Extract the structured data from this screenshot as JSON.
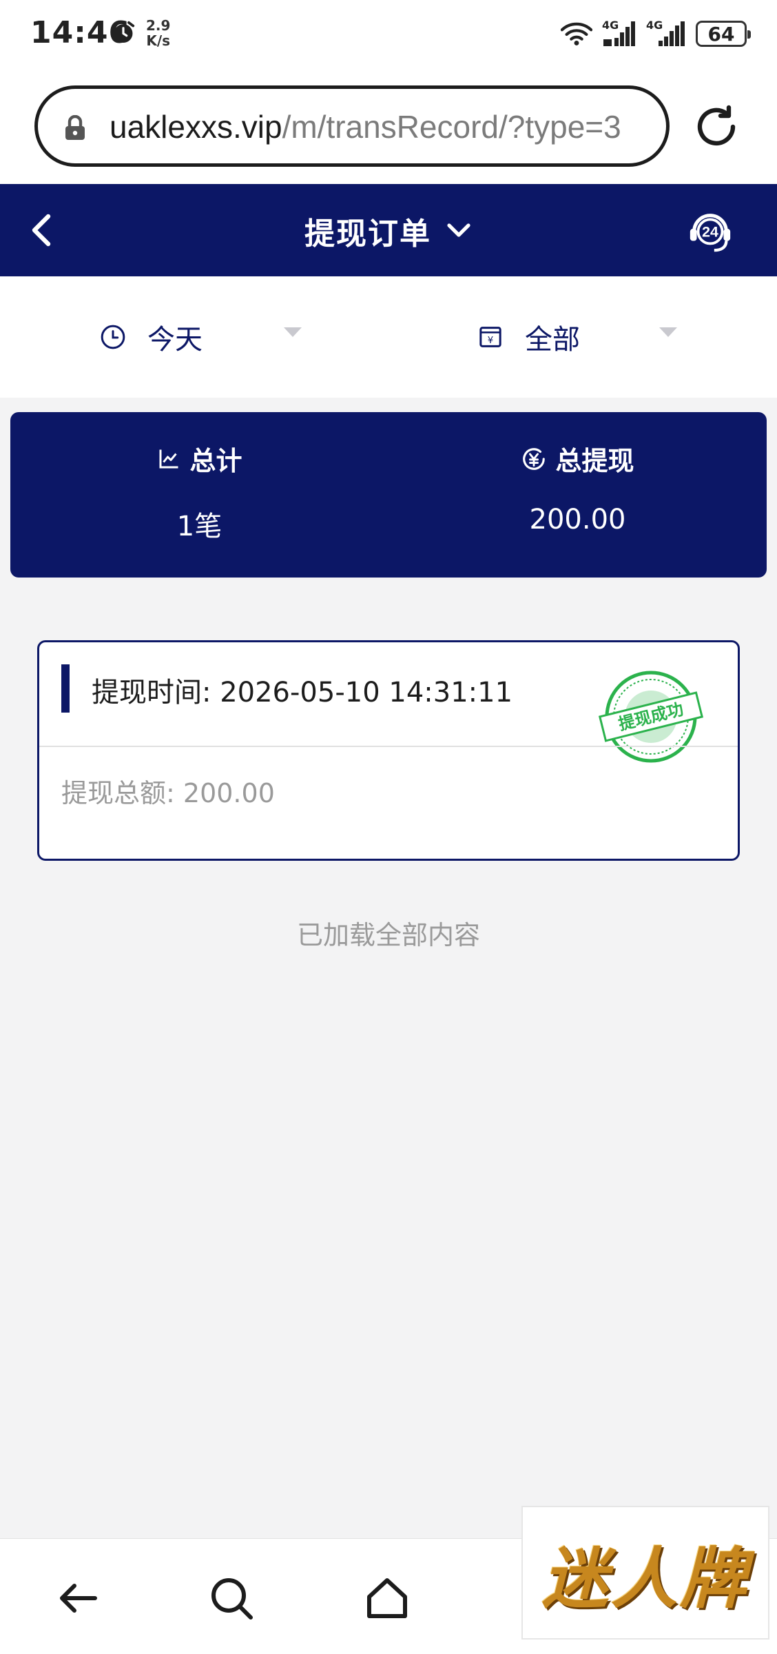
{
  "status_bar": {
    "time": "14:46",
    "speed_value": "2.9",
    "speed_unit": "K/s",
    "net1": "4G",
    "net2": "4G",
    "battery": "64"
  },
  "browser": {
    "url_domain": "uaklexxs.vip",
    "url_path": "/m/transRecord/?type=3"
  },
  "header": {
    "title": "提现订单"
  },
  "filters": {
    "date": "今天",
    "status": "全部"
  },
  "summary": {
    "total_label": "总计",
    "total_value": "1笔",
    "withdraw_label": "总提现",
    "withdraw_value": "200.00"
  },
  "records": [
    {
      "time_label": "提现时间:",
      "time": "2026-05-10 14:31:11",
      "amount_label": "提现总额:",
      "amount": "200.00",
      "stamp": "提现成功"
    }
  ],
  "footer_note": "已加载全部内容",
  "watermark": "迷人牌",
  "colors": {
    "primary": "#0c1766",
    "background": "#f3f3f4",
    "stamp": "#2bb24c",
    "muted": "#9a9a9a"
  }
}
